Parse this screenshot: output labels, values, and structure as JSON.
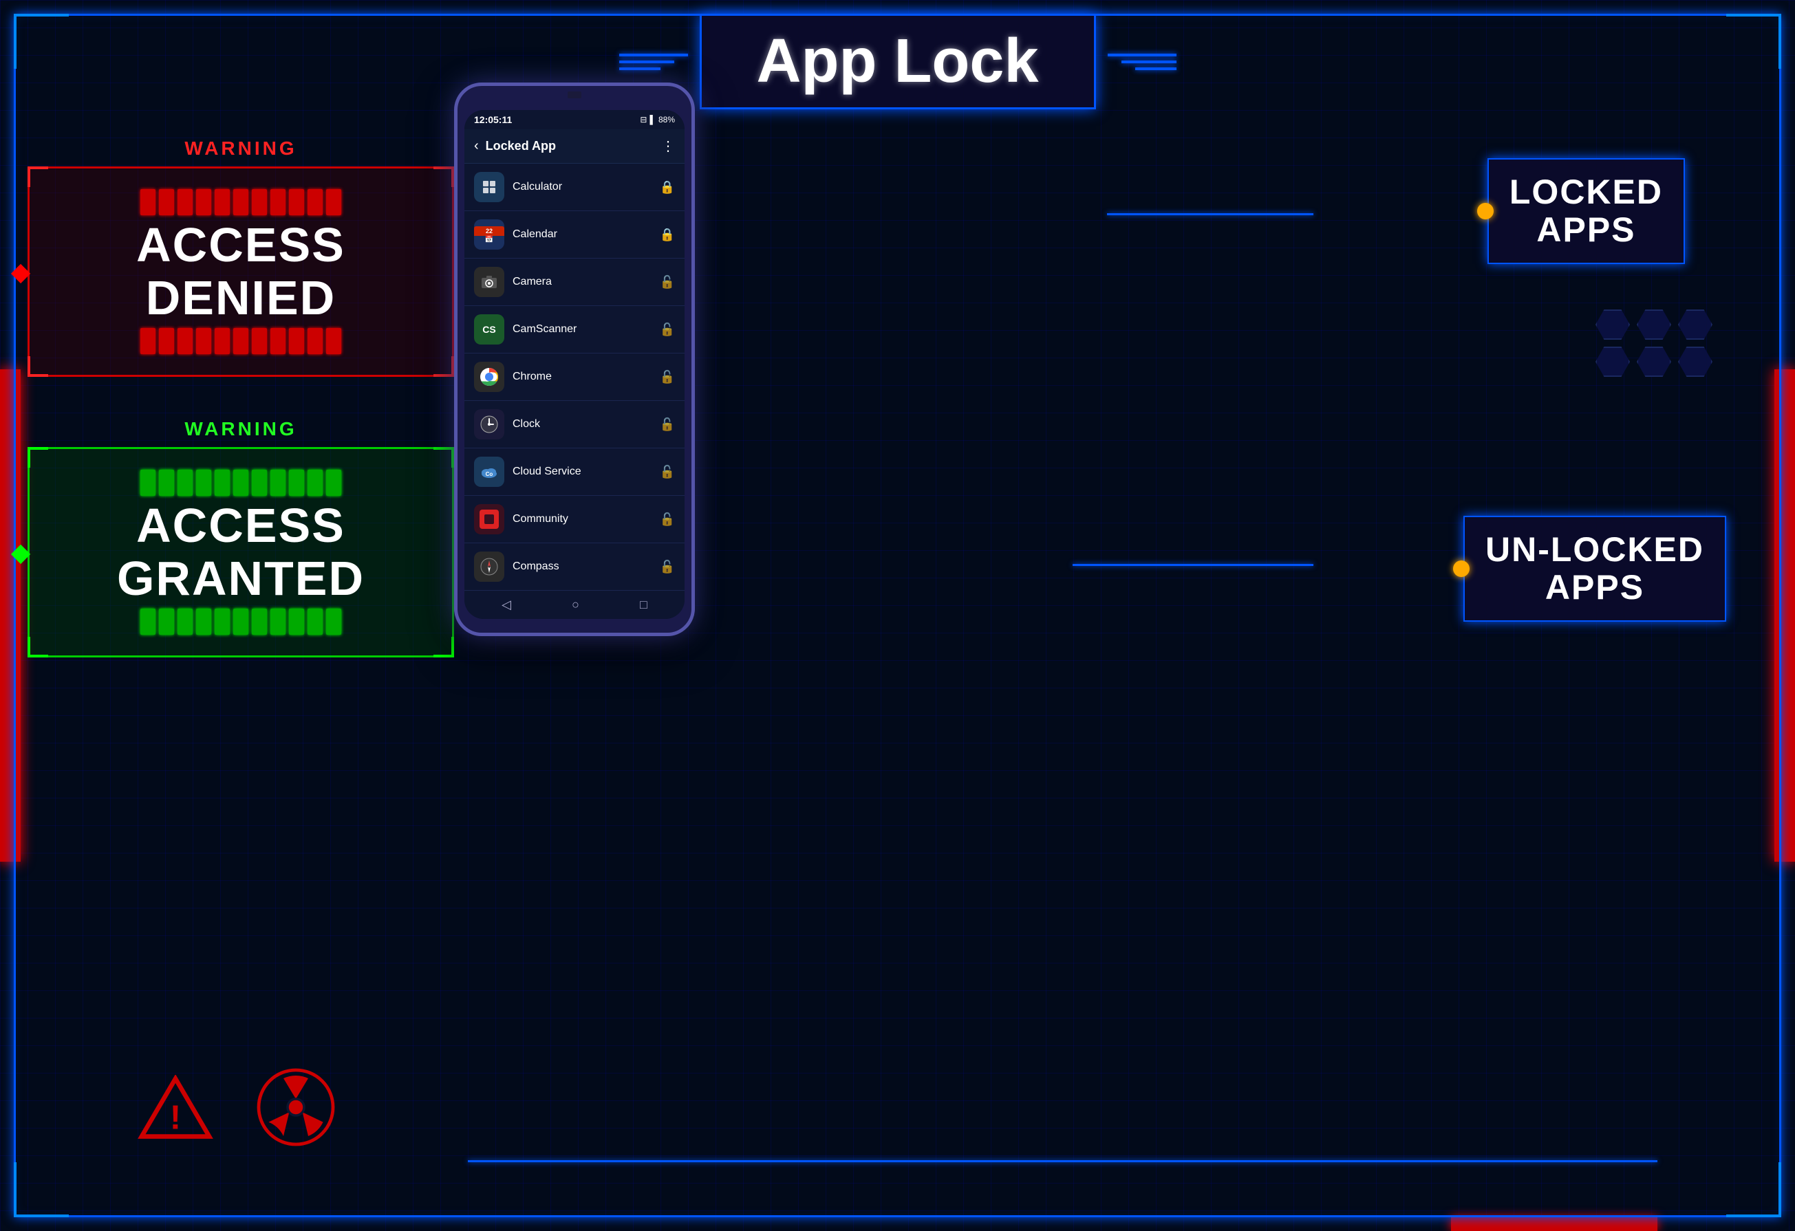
{
  "app": {
    "title": "App Lock",
    "phone": {
      "status_time": "12:05:11",
      "status_battery": "88%",
      "header_title": "Locked App",
      "apps": [
        {
          "name": "Calculator",
          "icon": "⊞",
          "locked": true,
          "icon_class": "app-icon-calc"
        },
        {
          "name": "Calendar",
          "icon": "📅",
          "locked": true,
          "icon_class": "app-icon-calendar"
        },
        {
          "name": "Camera",
          "icon": "📷",
          "locked": false,
          "icon_class": "app-icon-camera"
        },
        {
          "name": "CamScanner",
          "icon": "CS",
          "locked": false,
          "icon_class": "app-icon-camscanner"
        },
        {
          "name": "Chrome",
          "icon": "◉",
          "locked": false,
          "icon_class": "app-icon-chrome"
        },
        {
          "name": "Clock",
          "icon": "⏰",
          "locked": false,
          "icon_class": "app-icon-clock"
        },
        {
          "name": "Cloud Service",
          "icon": "Co",
          "locked": false,
          "icon_class": "app-icon-cloud"
        },
        {
          "name": "Community",
          "icon": "■",
          "locked": false,
          "icon_class": "app-icon-community"
        },
        {
          "name": "Compass",
          "icon": "🧭",
          "locked": false,
          "icon_class": "app-icon-compass"
        }
      ]
    },
    "access_denied": {
      "warning": "WARNING",
      "line1": "ACCESS",
      "line2": "DENIED"
    },
    "access_granted": {
      "warning": "WARNING",
      "line1": "ACCESS",
      "line2": "GRANTED"
    },
    "locked_apps_label": "LOCKED\nAPPS",
    "unlocked_apps_label": "UN-LOCKED\nAPPS"
  }
}
